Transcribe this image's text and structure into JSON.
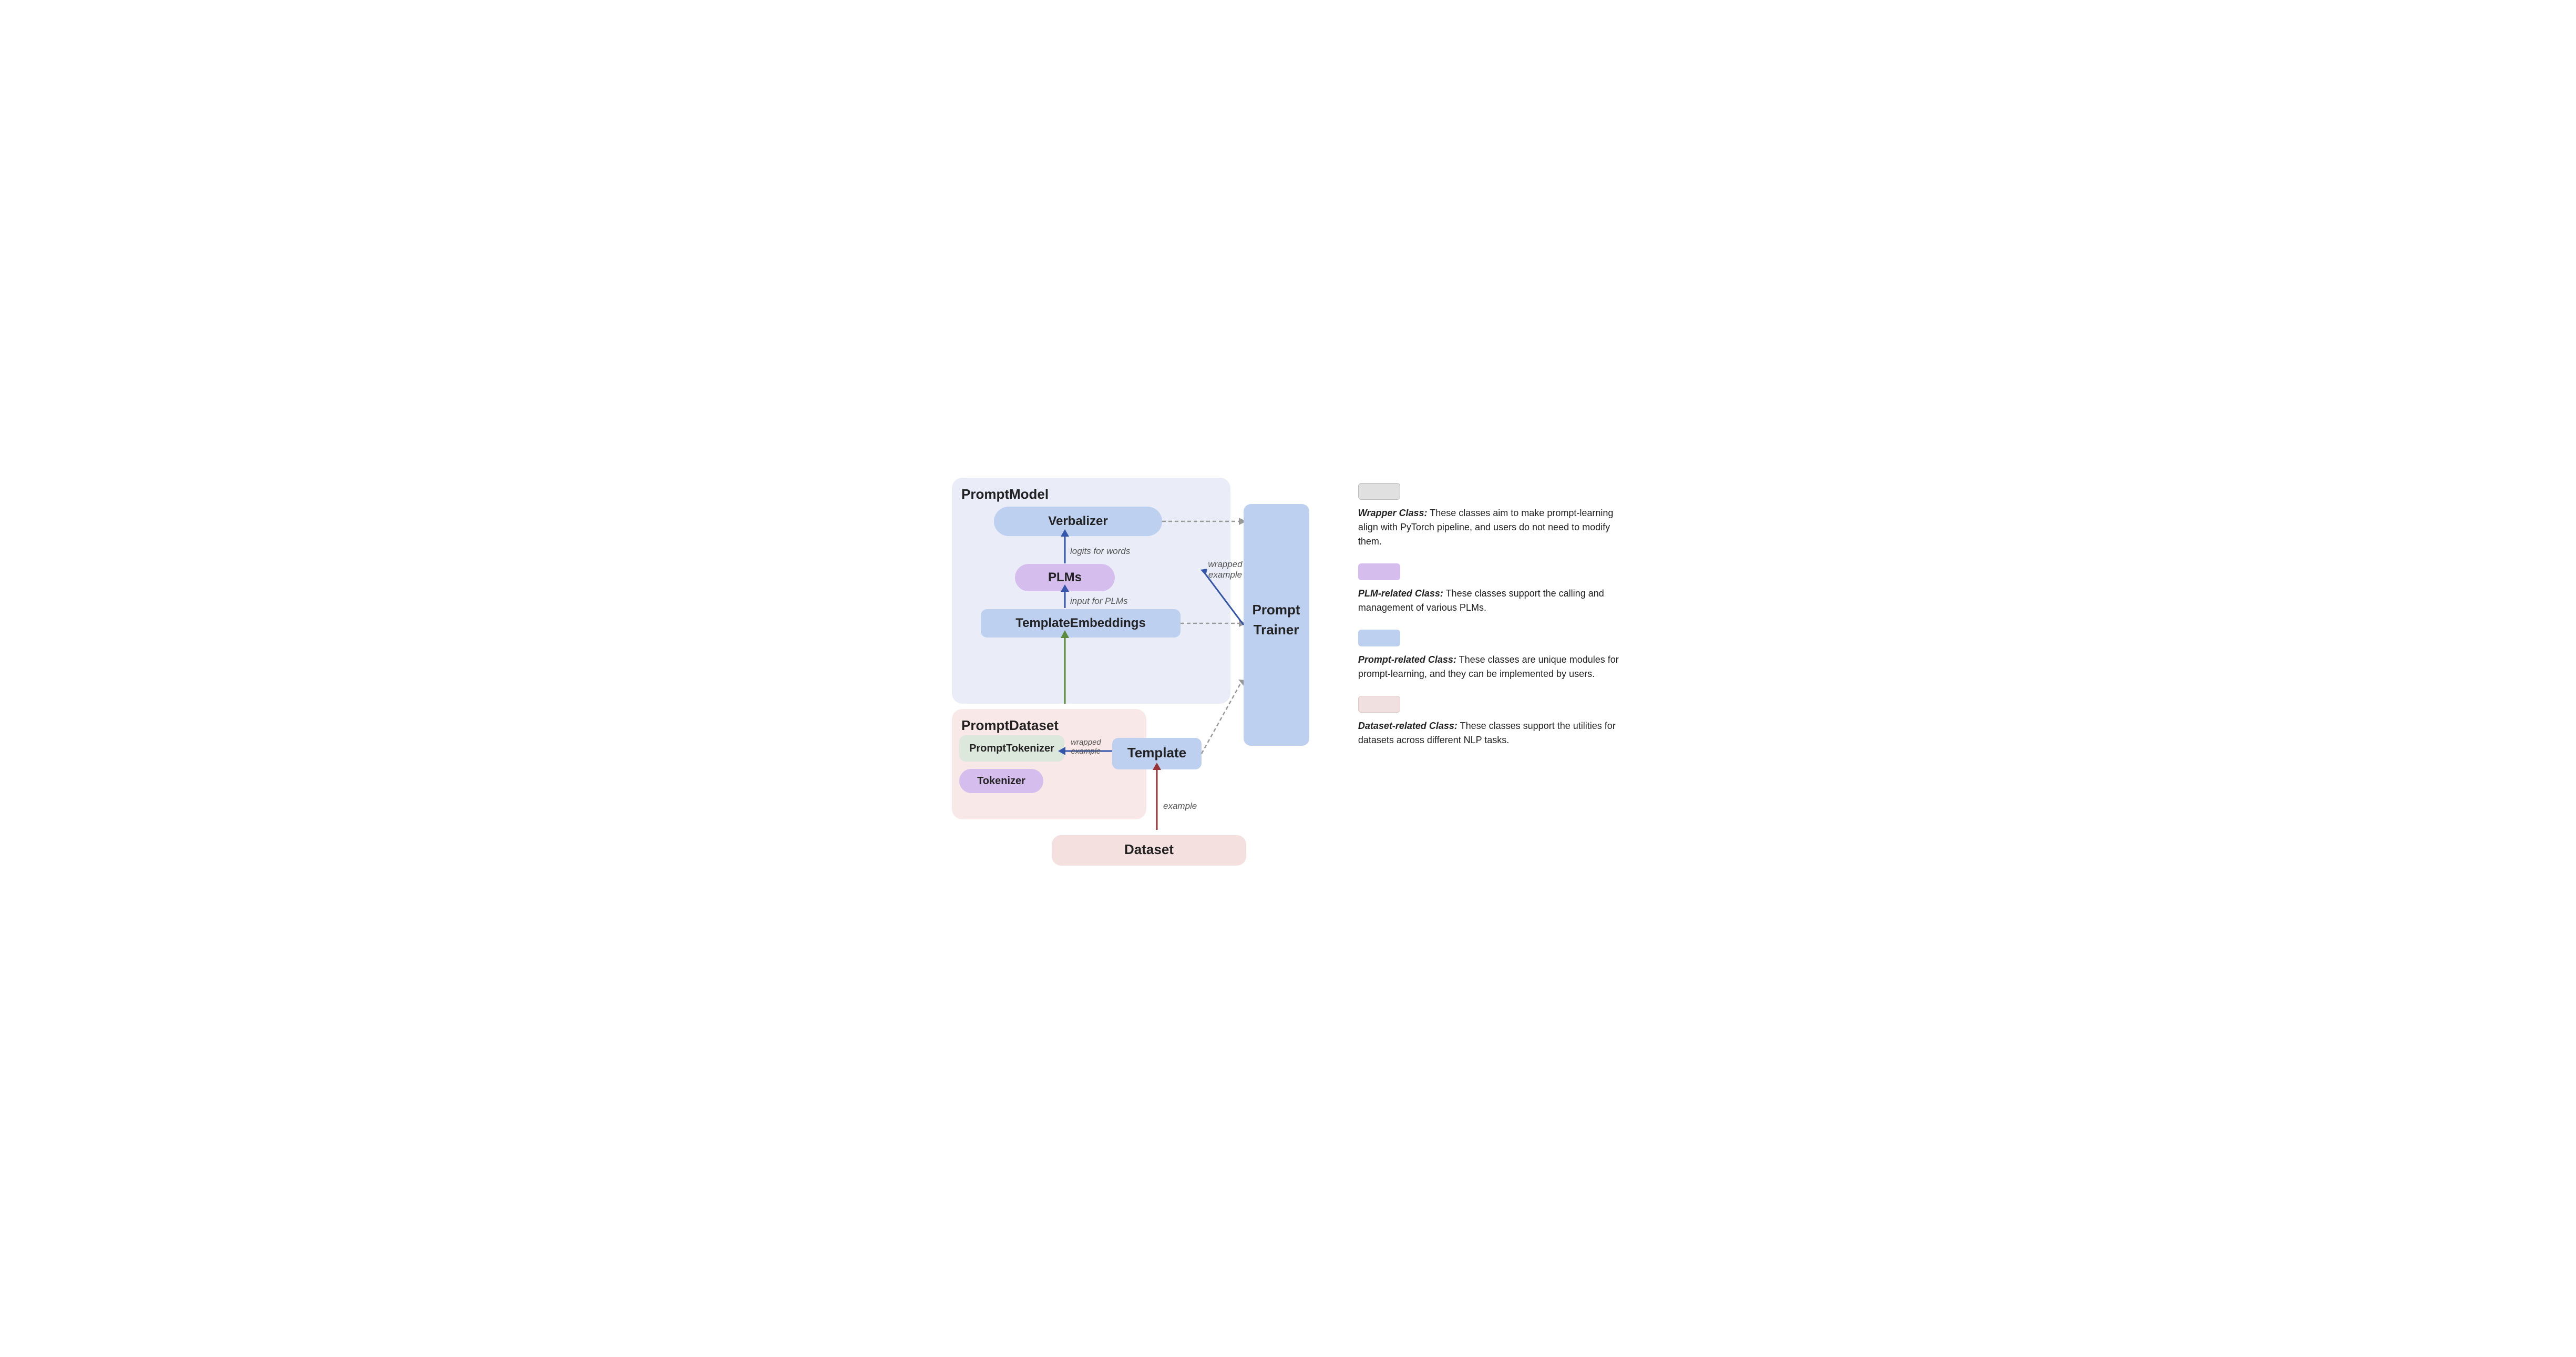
{
  "diagram": {
    "prompt_model_title": "PromptModel",
    "verbalizer_label": "Verbalizer",
    "logits_label": "logits for words",
    "plms_label": "PLMs",
    "input_plms_label": "input for PLMs",
    "template_embeddings_label": "TemplateEmbeddings",
    "prompt_dataset_title": "PromptDataset",
    "prompt_tokenizer_label": "PromptTokenizer",
    "tokenizer_label": "Tokenizer",
    "template_label": "Template",
    "wrapped_example_label": "wrapped example",
    "example_label": "example",
    "dataset_label": "Dataset",
    "prompt_trainer_label": "Prompt\nTrainer",
    "wrapped_example_right": "wrapped example"
  },
  "legend": {
    "items": [
      {
        "swatch_color": "#e8e8e8",
        "label": "Wrapper Class:",
        "description": "These classes aim to make prompt-learning align with PyTorch pipeline, and users do not need to modify them."
      },
      {
        "swatch_color": "#d8c8f0",
        "label": "PLM-related Class:",
        "description": "These classes support the calling and management of various PLMs."
      },
      {
        "swatch_color": "#c5d8f7",
        "label": "Prompt-related Class:",
        "description": "These classes are unique modules for prompt-learning, and they can be implemented by users."
      },
      {
        "swatch_color": "#f0e0e0",
        "label": "Dataset-related Class:",
        "description": "These classes support the utilities for datasets across different NLP tasks."
      }
    ]
  }
}
